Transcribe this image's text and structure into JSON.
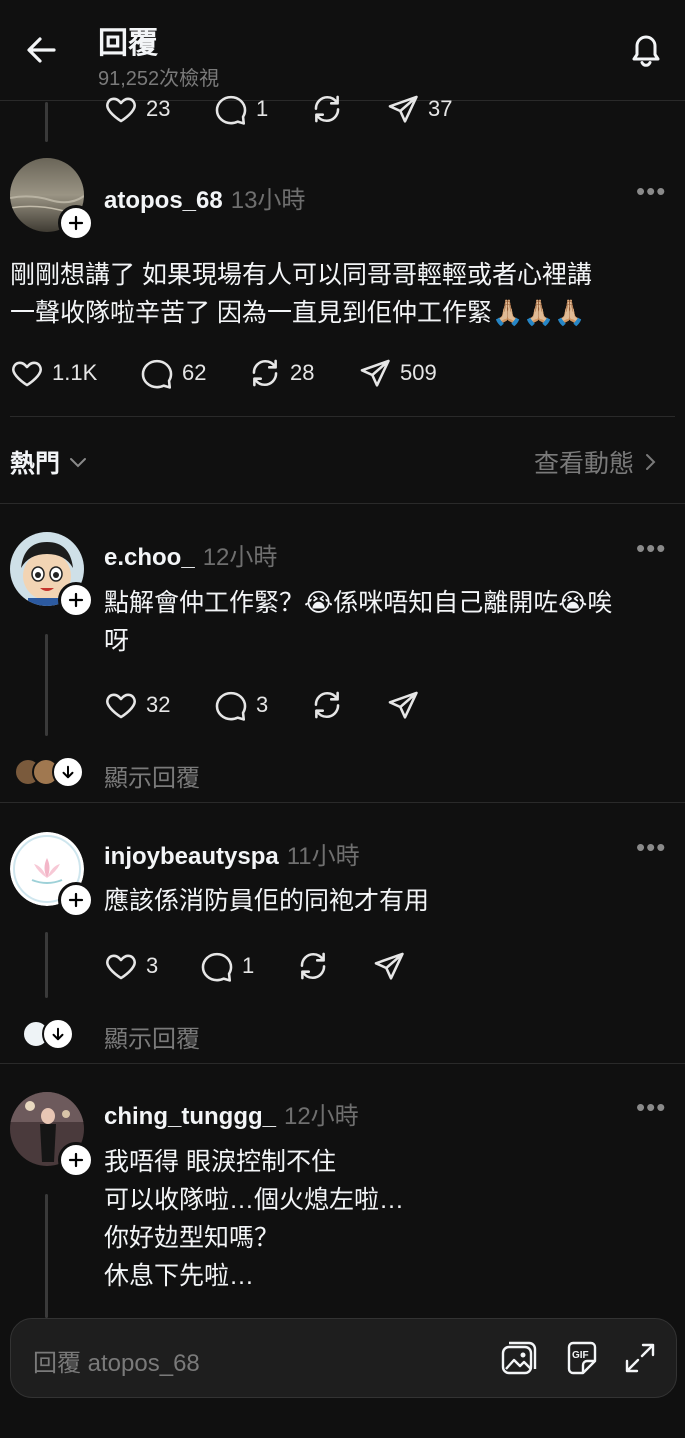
{
  "header": {
    "title": "回覆",
    "views": "91,252次檢視"
  },
  "top_actions": {
    "likes": "23",
    "replies": "1",
    "shares": "37"
  },
  "main_post": {
    "username": "atopos_68",
    "time": "13小時",
    "text_line1": "剛剛想講了 如果現場有人可以同哥哥輕輕或者心裡講",
    "text_line2": "一聲收隊啦辛苦了 因為一直見到佢仲工作緊🙏🏼🙏🏼🙏🏼",
    "likes": "1.1K",
    "replies": "62",
    "reposts": "28",
    "shares": "509"
  },
  "sort": {
    "label": "熱門",
    "activity": "查看動態"
  },
  "comments": [
    {
      "username": "e.choo_",
      "time": "12小時",
      "line1": "點解會仲工作緊？😭係咪唔知自己離開咗😭唉",
      "line2": "呀",
      "likes": "32",
      "replies": "3",
      "show_replies": "顯示回覆"
    },
    {
      "username": "injoybeautyspa",
      "time": "11小時",
      "line1": "應該係消防員佢的同袍才有用",
      "likes": "3",
      "replies": "1",
      "show_replies": "顯示回覆"
    },
    {
      "username": "ching_tunggg_",
      "time": "12小時",
      "line1": "我唔得 眼淚控制不住",
      "line2": "可以收隊啦…個火熄左啦…",
      "line3": "你好攰型知嗎？",
      "line4": "休息下先啦…"
    }
  ],
  "reply_bar": {
    "placeholder": "回覆 atopos_68"
  },
  "colors": {
    "background": "#101010",
    "text": "#f3f5f7",
    "muted": "#7a7a7a"
  },
  "icons": [
    "back-arrow-icon",
    "bell-icon",
    "heart-icon",
    "comment-icon",
    "repost-icon",
    "share-icon",
    "more-icon",
    "plus-icon",
    "chevron-down-icon",
    "chevron-right-icon",
    "image-icon",
    "gif-icon",
    "expand-icon"
  ]
}
